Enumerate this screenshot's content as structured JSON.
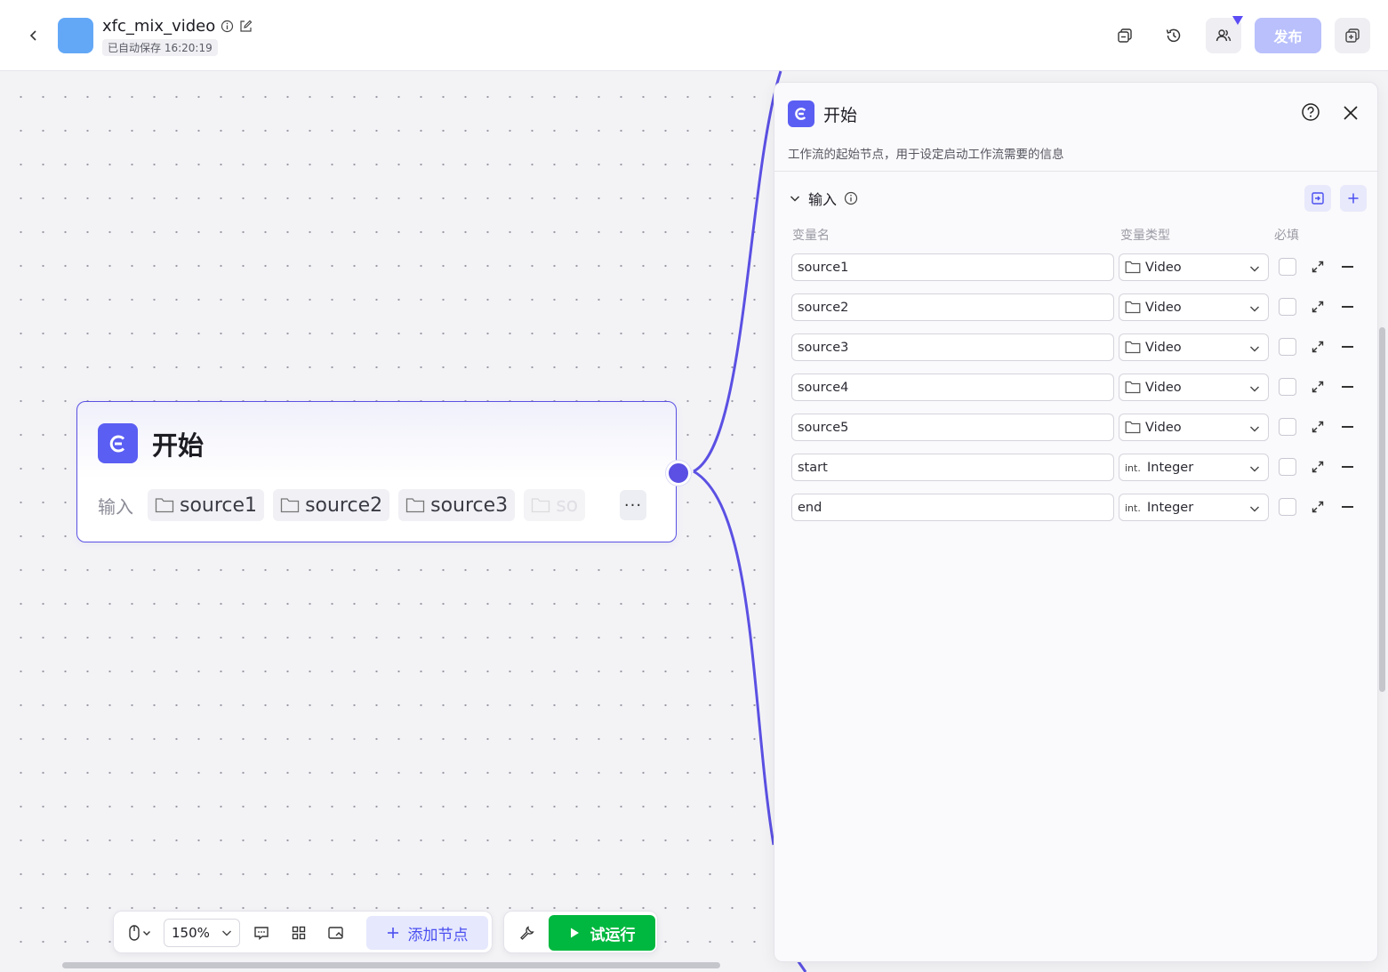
{
  "header": {
    "title": "xfc_mix_video",
    "autosave": "已自动保存 16:20:19",
    "publish_label": "发布"
  },
  "node": {
    "title": "开始",
    "inputs_label": "输入",
    "chips": [
      "source1",
      "source2",
      "source3",
      "so"
    ],
    "more_label": "···"
  },
  "toolbar": {
    "zoom": "150%",
    "add_node_label": "添加节点",
    "run_label": "试运行"
  },
  "panel": {
    "title": "开始",
    "description": "工作流的起始节点，用于设定启动工作流需要的信息",
    "section_title": "输入",
    "col_name": "变量名",
    "col_type": "变量类型",
    "col_required": "必填",
    "rows": [
      {
        "name": "source1",
        "type": "Video",
        "type_icon": "folder-icon"
      },
      {
        "name": "source2",
        "type": "Video",
        "type_icon": "folder-icon"
      },
      {
        "name": "source3",
        "type": "Video",
        "type_icon": "folder-icon"
      },
      {
        "name": "source4",
        "type": "Video",
        "type_icon": "folder-icon"
      },
      {
        "name": "source5",
        "type": "Video",
        "type_icon": "folder-icon"
      },
      {
        "name": "start",
        "type": "Integer",
        "type_icon": "int-icon"
      },
      {
        "name": "end",
        "type": "Integer",
        "type_icon": "int-icon"
      }
    ]
  },
  "colors": {
    "accent": "#5b50e3",
    "node_icon": "#5b5ef2",
    "run_green": "#00b83f",
    "publish_disabled": "#b9c0fb",
    "app_icon": "#63a8f7"
  }
}
